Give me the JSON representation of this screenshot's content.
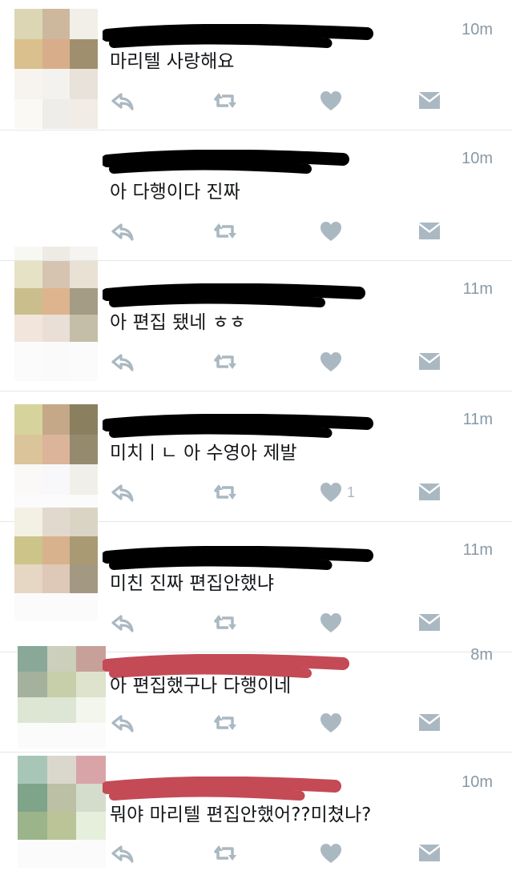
{
  "colors": {
    "divider": "#e1e8ed",
    "icon": "#aab8c2",
    "time": "#8899a6",
    "text": "#14171a",
    "redact_black": "#000000",
    "redact_red": "#c44a56"
  },
  "icons": [
    "reply-icon",
    "retweet-icon",
    "like-icon",
    "dm-icon"
  ],
  "tweets": [
    {
      "time": "10m",
      "text": "마리텔 사랑해요",
      "like_count": "",
      "redaction": "black",
      "avatar_colors": [
        "#dcd6b4",
        "#cdb89e",
        "#f2efe8",
        "#d9c08c",
        "#d8ae8a",
        "#a08f6e",
        "#f7f4f0",
        "#f4f2ef",
        "#e8e2da",
        "#faf9f4",
        "#efede9",
        "#f1ece5"
      ]
    },
    {
      "time": "10m",
      "text": "아 다행이다 진짜",
      "like_count": "",
      "redaction": "black",
      "avatar_colors": [
        "#f8f8f2",
        "#eeebe5",
        "#f6f4f0",
        "#cac38a",
        "#b89878",
        "#6e5a48",
        "#e2cfae",
        "#dcc3ae",
        "#a39a82",
        "#fbfbfb",
        "#fafafa",
        "#fbfbfb"
      ]
    },
    {
      "time": "11m",
      "text": "아 편집 됐네 ㅎㅎ",
      "like_count": "",
      "redaction": "black",
      "avatar_colors": [
        "#e6e2c6",
        "#d7c4b0",
        "#e8e1d4",
        "#cabf8c",
        "#ddb48e",
        "#a59c85",
        "#f2e6dc",
        "#e9dfd6",
        "#c4bda8",
        "#fbfbfb",
        "#fafafa",
        "#fbfbfb"
      ]
    },
    {
      "time": "11m",
      "text": "미치ㅣㄴ 아 수영아 제발",
      "like_count": "1",
      "redaction": "black",
      "avatar_colors": [
        "#d6d49c",
        "#c4a888",
        "#8a8060",
        "#dcc49a",
        "#dcb49a",
        "#968a6e",
        "#faf9f8",
        "#f8f8fa",
        "#f1efe9",
        "#fbfbfb",
        "#fbfbfb",
        "#fbfbfb"
      ]
    },
    {
      "time": "11m",
      "text": "미친 진짜 편집안했냐",
      "like_count": "",
      "redaction": "black",
      "avatar_colors": [
        "#f3f1e3",
        "#e1d9cd",
        "#dad4c4",
        "#cdc48a",
        "#d8b28c",
        "#a99a74",
        "#e6d6c4",
        "#dec8b8",
        "#a39882",
        "#fbfbfb",
        "#fbfbfb",
        "#fbfbfb"
      ]
    },
    {
      "time": "8m",
      "text": "아 편집했구나 다행이네",
      "like_count": "",
      "redaction": "red",
      "avatar_colors": [
        "#8aa898",
        "#cbcfbc",
        "#c8a09a",
        "#a4b19c",
        "#c6cfaa",
        "#dde3cc",
        "#dde6d2",
        "#dde5d4",
        "#f3f6ec",
        "#fbfbfb",
        "#fbfbfb",
        "#fbfbfb"
      ]
    },
    {
      "time": "10m",
      "text": "뭐야 마리텔 편집안했어??미쳤나?",
      "like_count": "",
      "redaction": "red",
      "avatar_colors": [
        "#a8c6b8",
        "#dad8cc",
        "#d8a4a8",
        "#7ea48a",
        "#bcc0a4",
        "#d4dccc",
        "#9cb48a",
        "#bac496",
        "#e6eedc",
        "#fbfbfb",
        "#fbfbfb",
        "#fbfbfb"
      ]
    }
  ]
}
